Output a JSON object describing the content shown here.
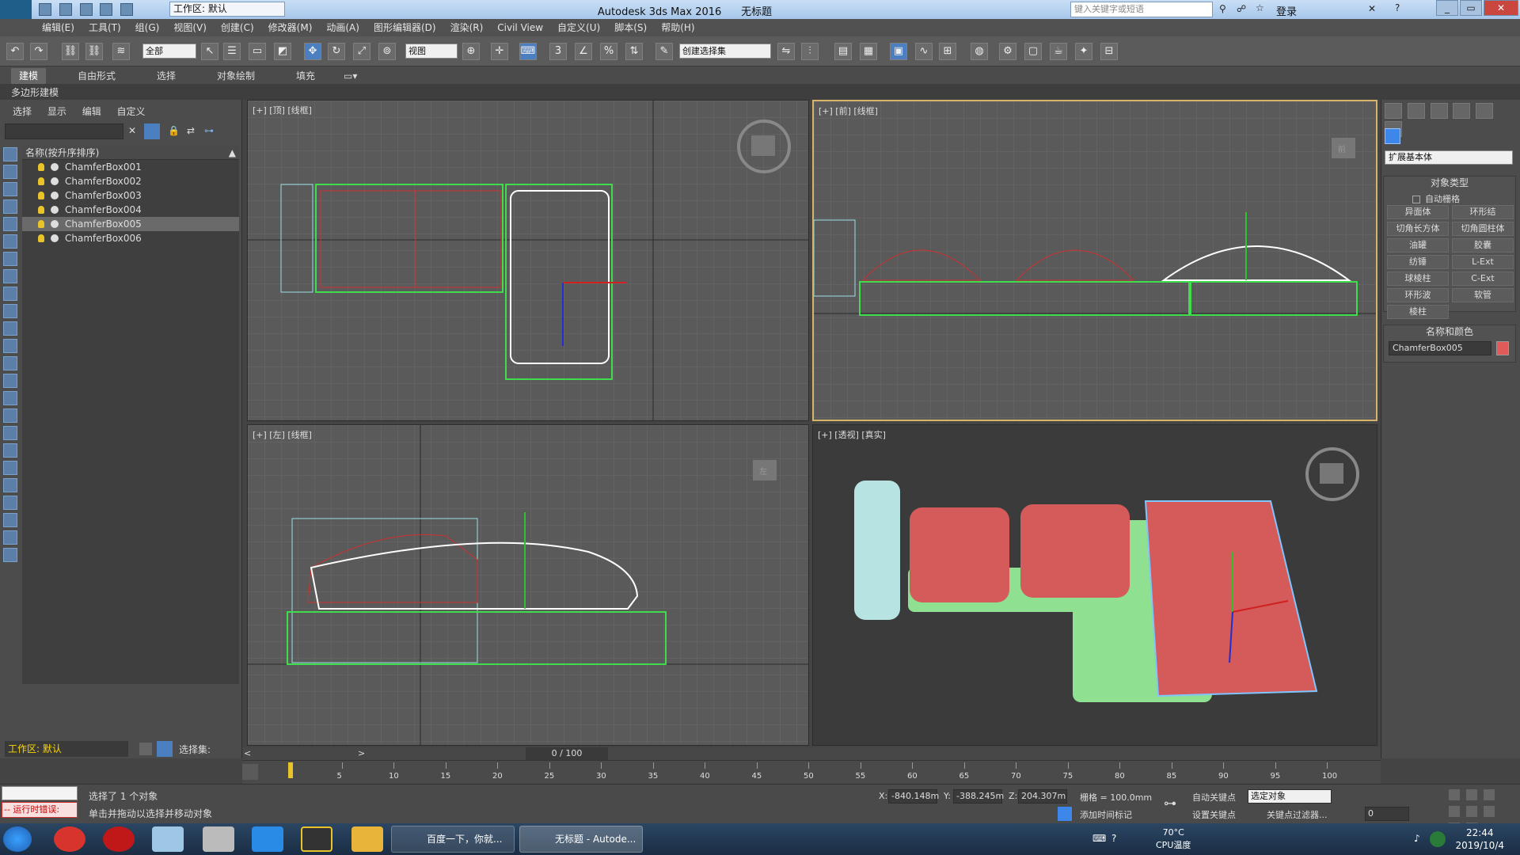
{
  "titlebar": {
    "workspace": "工作区: 默认",
    "app_title": "Autodesk 3ds Max 2016",
    "doc_title": "无标题",
    "search_placeholder": "键入关键字或短语",
    "login": "登录"
  },
  "menu": [
    "编辑(E)",
    "工具(T)",
    "组(G)",
    "视图(V)",
    "创建(C)",
    "修改器(M)",
    "动画(A)",
    "图形编辑器(D)",
    "渲染(R)",
    "Civil View",
    "自定义(U)",
    "脚本(S)",
    "帮助(H)"
  ],
  "toolbar": {
    "filter_select": "全部",
    "ref_coord": "视图",
    "selection_set": "创建选择集",
    "snap_3": "3",
    "snap_percent": "%"
  },
  "ribbon": {
    "tabs": [
      "建模",
      "自由形式",
      "选择",
      "对象绘制",
      "填充"
    ],
    "active_tab": "建模",
    "sub_label": "多边形建模"
  },
  "explorer": {
    "tabs": [
      "选择",
      "显示",
      "编辑",
      "自定义"
    ],
    "header": "名称(按升序排序)",
    "items": [
      "ChamferBox001",
      "ChamferBox002",
      "ChamferBox003",
      "ChamferBox004",
      "ChamferBox005",
      "ChamferBox006"
    ],
    "selected_index": 4,
    "workspace": "工作区: 默认",
    "selset_label": "选择集:"
  },
  "viewports": {
    "top": "[+] [顶] [线框]",
    "front": "[+] [前] [线框]",
    "left": "[+] [左] [线框]",
    "persp": "[+] [透视] [真实]",
    "front_cube": "前",
    "left_cube": "左"
  },
  "command_panel": {
    "category": "扩展基本体",
    "object_type_header": "对象类型",
    "autogrid": "自动栅格",
    "buttons": [
      "异面体",
      "环形结",
      "切角长方体",
      "切角圆柱体",
      "油罐",
      "胶囊",
      "纺锤",
      "L-Ext",
      "球棱柱",
      "C-Ext",
      "环形波",
      "软管",
      "棱柱"
    ],
    "name_color_header": "名称和颜色",
    "object_name": "ChamferBox005",
    "object_color": "#e05a5a",
    "swatch_color": "#3d86ea"
  },
  "timeline": {
    "counter": "0 / 100",
    "ticks": [
      "5",
      "10",
      "15",
      "20",
      "25",
      "30",
      "35",
      "40",
      "45",
      "50",
      "55",
      "60",
      "65",
      "70",
      "75",
      "80",
      "85",
      "90",
      "95",
      "100"
    ]
  },
  "status": {
    "selected": "选择了 1 个对象",
    "hint": "单击并拖动以选择并移动对象",
    "error": "-- 运行时错误:",
    "x_label": "X:",
    "x": "-840.148m",
    "y_label": "Y:",
    "y": "-388.245m",
    "z_label": "Z:",
    "z": "204.307m",
    "grid": "栅格 = 100.0mm",
    "add_time_tag": "添加时间标记",
    "auto_key": "自动关键点",
    "set_key": "设置关键点",
    "selected_obj": "选定对象",
    "key_filters": "关键点过滤器...",
    "frame": "0"
  },
  "taskbar": {
    "task1": "百度一下，你就...",
    "task2": "无标题 - Autode...",
    "temp": "70°C",
    "temp_label": "CPU温度",
    "time": "22:44",
    "date": "2019/10/4"
  }
}
